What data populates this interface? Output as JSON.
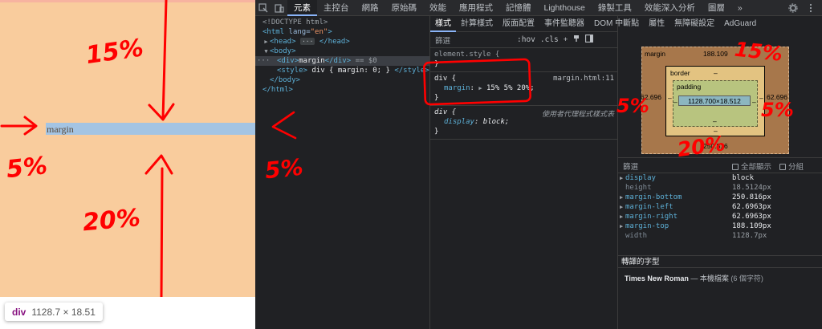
{
  "page": {
    "content_text": "margin",
    "annotations": [
      "15%",
      "5%",
      "20%"
    ],
    "tooltip": {
      "tag": "div",
      "size": "1128.7 × 18.51"
    }
  },
  "toolbar": {
    "tabs": [
      "元素",
      "主控台",
      "網路",
      "原始碼",
      "效能",
      "應用程式",
      "記憶體",
      "Lighthouse",
      "錄製工具",
      "效能深入分析",
      "圖層"
    ],
    "more": "»",
    "inspect_icon": "inspect-element-icon",
    "device_icon": "device-toolbar-icon"
  },
  "elements": {
    "lines": [
      {
        "kind": "plain",
        "text": "<!DOCTYPE html>"
      },
      {
        "kind": "open",
        "tag": "html",
        "attr": "lang",
        "val": "\"en\""
      },
      {
        "kind": "collapsed",
        "tag": "head"
      },
      {
        "kind": "open",
        "tag": "body"
      },
      {
        "kind": "selected",
        "tag": "div",
        "text": "margin",
        "suffix": "== $0"
      },
      {
        "kind": "style",
        "text": "div { margin: 0; }"
      },
      {
        "kind": "close",
        "tag": "body"
      },
      {
        "kind": "close",
        "tag": "html"
      }
    ]
  },
  "styles": {
    "tabs": [
      "樣式",
      "計算樣式",
      "版面配置",
      "事件監聽器",
      "DOM 中斷點",
      "屬性",
      "無障礙設定",
      "AdGuard"
    ],
    "filter_placeholder": "篩選",
    "hov": ":hov",
    "cls": ".cls",
    "element_style": "element.style {",
    "rule1": {
      "selector": "div {",
      "prop": "margin",
      "value": "15% 5% 20%",
      "source": "margin.html:11"
    },
    "rule2": {
      "selector": "div {",
      "prop": "display",
      "value": "block",
      "source": "使用者代理程式樣式表"
    },
    "close": "}"
  },
  "computed": {
    "box": {
      "margin_label": "margin",
      "margin_top": "188.109",
      "margin_left": "62.696",
      "margin_right": "62.696",
      "margin_bottom": "250.816",
      "border_label": "border",
      "border_value": "–",
      "padding_label": "padding",
      "padding_value": "–",
      "content": "1128.700×18.512"
    },
    "filter_label": "篩選",
    "show_all": "全部顯示",
    "group": "分組",
    "props": [
      {
        "name": "display",
        "value": "block",
        "expandable": true,
        "dim": false
      },
      {
        "name": "height",
        "value": "18.5124px",
        "expandable": false,
        "dim": true
      },
      {
        "name": "margin-bottom",
        "value": "250.816px",
        "expandable": true,
        "dim": false
      },
      {
        "name": "margin-left",
        "value": "62.6963px",
        "expandable": true,
        "dim": false
      },
      {
        "name": "margin-right",
        "value": "62.6963px",
        "expandable": true,
        "dim": false
      },
      {
        "name": "margin-top",
        "value": "188.109px",
        "expandable": true,
        "dim": false
      },
      {
        "name": "width",
        "value": "1128.7px",
        "expandable": false,
        "dim": true
      }
    ],
    "fonts_header": "轉譯的字型",
    "font_name": "Times New Roman",
    "font_desc": "— 本機檔案",
    "font_count": "(6 個字符)"
  },
  "colors": {
    "annotation": "#ff0000",
    "page_bg": "#f9cc9d",
    "content_bg": "#a4c4e3",
    "accent": "#8ab4f8"
  }
}
